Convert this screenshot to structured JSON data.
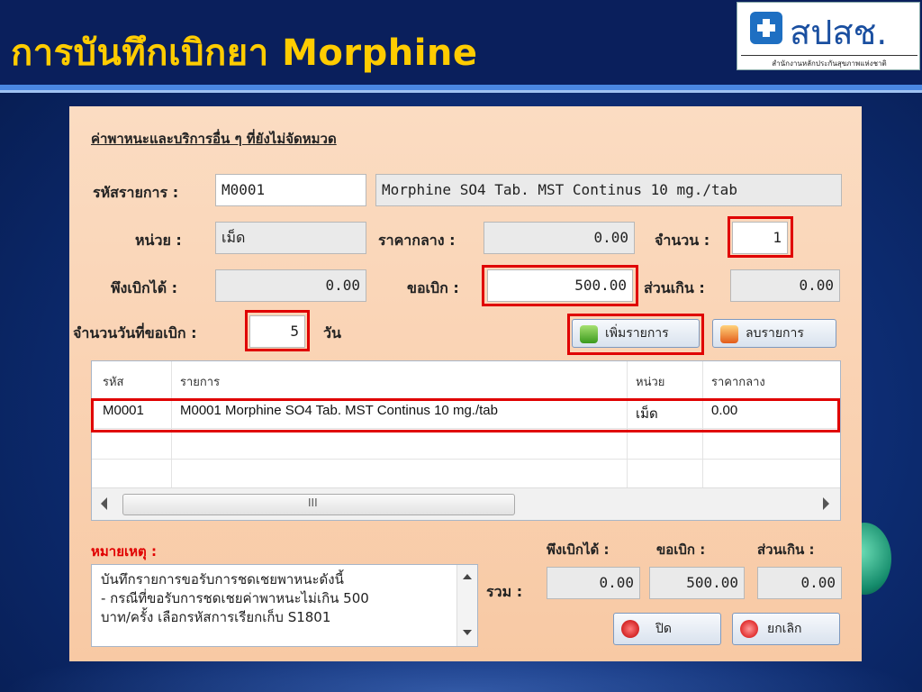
{
  "slide": {
    "title": "การบันทึกเบิกยา Morphine",
    "logo_text": "สปสช.",
    "logo_subtitle": "สำนักงานหลักประกันสุขภาพแห่งชาติ"
  },
  "form": {
    "section_title": "ค่าพาหนะและบริการอื่น ๆ ที่ยังไม่จัดหมวด",
    "item_code_label": "รหัสรายการ :",
    "item_code_value": "M0001",
    "item_name_value": "Morphine SO4 Tab. MST Continus 10 mg./tab",
    "unit_label": "หน่วย :",
    "unit_value": "เม็ด",
    "median_price_label": "ราคากลาง :",
    "median_price_value": "0.00",
    "quantity_label": "จำนวน :",
    "quantity_value": "1",
    "eligible_label": "พึงเบิกได้ :",
    "eligible_value": "0.00",
    "request_label": "ขอเบิก :",
    "request_value": "500.00",
    "excess_label": "ส่วนเกิน :",
    "excess_value": "0.00",
    "days_label": "จำนวนวันที่ขอเบิก :",
    "days_value": "5",
    "days_unit": "วัน",
    "add_button": "เพิ่มรายการ",
    "delete_button": "ลบรายการ"
  },
  "table": {
    "headers": [
      "รหัส",
      "รายการ",
      "หน่วย",
      "ราคากลาง"
    ],
    "rows": [
      [
        "M0001",
        "M0001 Morphine SO4 Tab. MST Continus 10 mg./tab",
        "เม็ด",
        "0.00"
      ]
    ],
    "scroll_grip": "III"
  },
  "footer": {
    "remark_label": "หมายเหตุ :",
    "remark_text": "บันทึกรายการขอรับการชดเชยพาหนะดังนี้\n- กรณีที่ขอรับการชดเชยค่าพาหนะไม่เกิน 500\nบาท/ครั้ง เลือกรหัสการเรียกเก็บ S1801",
    "total_label": "รวม :",
    "total_eligible_label": "พึงเบิกได้ :",
    "total_request_label": "ขอเบิก :",
    "total_excess_label": "ส่วนเกิน :",
    "total_eligible_value": "0.00",
    "total_request_value": "500.00",
    "total_excess_value": "0.00",
    "close_button": "ปิด",
    "cancel_button": "ยกเลิก"
  },
  "colors": {
    "title": "#ffcc00",
    "highlight": "#e00000",
    "remark_label": "#e00000",
    "panel": "#f8c9a4"
  }
}
